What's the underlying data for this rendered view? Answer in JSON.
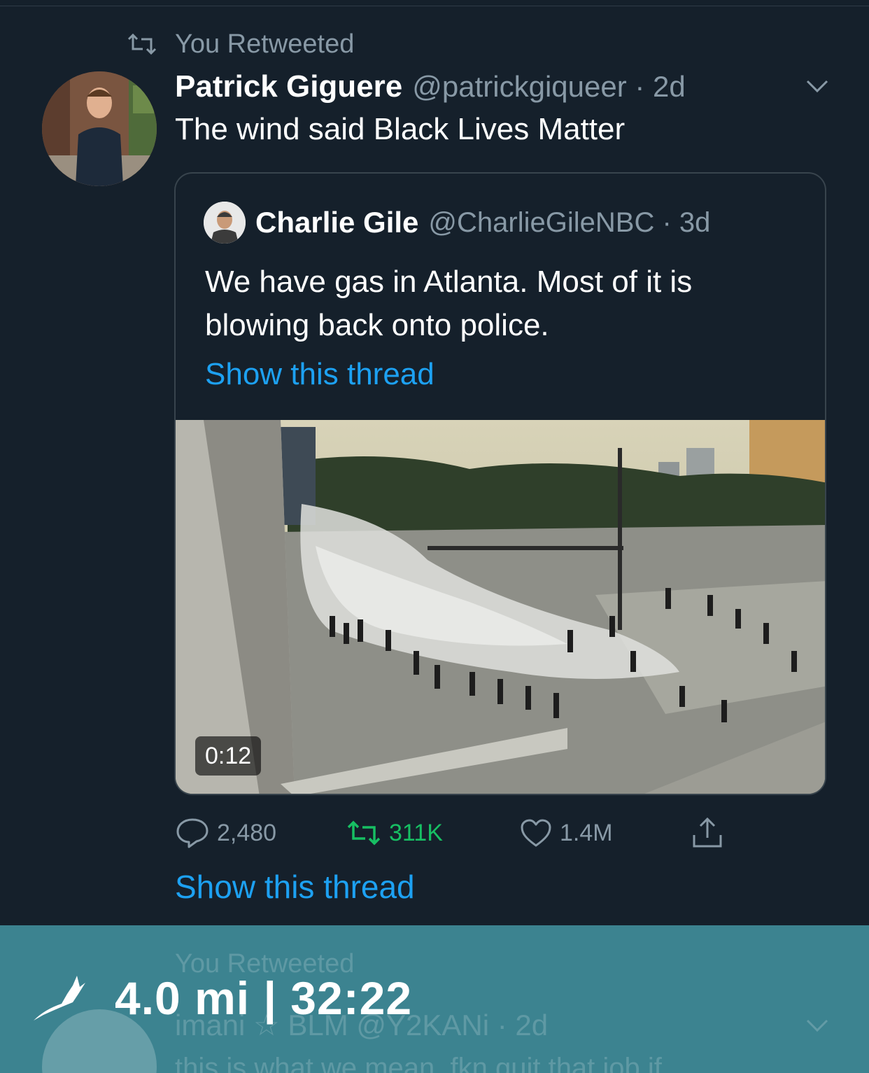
{
  "retweet_context": {
    "label": "You Retweeted"
  },
  "tweet": {
    "author_name": "Patrick Giguere",
    "author_handle": "@patrickgiqueer · 2d",
    "text": "The wind said Black Lives Matter",
    "show_thread": "Show this thread"
  },
  "quote": {
    "author_name": "Charlie Gile",
    "author_handle": "@CharlieGileNBC · 3d",
    "text": "We have gas in Atlanta. Most of it is blowing back onto police.",
    "show_thread": "Show this thread",
    "video_duration": "0:12"
  },
  "actions": {
    "replies": "2,480",
    "retweets": "311K",
    "likes": "1.4M"
  },
  "next_tweet": {
    "context": "You Retweeted",
    "author_line": "imani ☆ BLM @Y2KANi · 2d",
    "text": "this is what we mean. fkn quit that job if"
  },
  "overlay": {
    "stats": "4.0 mi | 32:22"
  },
  "colors": {
    "background": "#15202b",
    "secondary_text": "#8899a6",
    "link": "#1da1f2",
    "retweet_active": "#17bf63",
    "overlay_band": "#3c8390"
  },
  "icons": [
    "retweet-icon",
    "chevron-down-icon",
    "reply-icon",
    "like-icon",
    "share-icon",
    "strava-runner-icon"
  ]
}
